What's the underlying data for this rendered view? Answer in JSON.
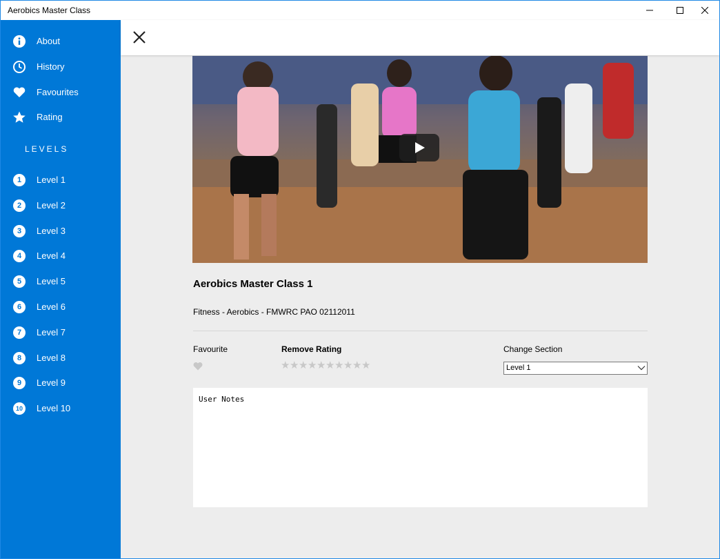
{
  "window": {
    "title": "Aerobics Master Class"
  },
  "sidebar": {
    "menu": [
      {
        "label": "About",
        "icon": "info-icon"
      },
      {
        "label": "History",
        "icon": "clock-icon"
      },
      {
        "label": "Favourites",
        "icon": "heart-icon"
      },
      {
        "label": "Rating",
        "icon": "star-icon"
      }
    ],
    "levels_heading": "LEVELS",
    "levels": [
      {
        "num": "1",
        "label": "Level 1"
      },
      {
        "num": "2",
        "label": "Level 2"
      },
      {
        "num": "3",
        "label": "Level 3"
      },
      {
        "num": "4",
        "label": "Level 4"
      },
      {
        "num": "5",
        "label": "Level 5"
      },
      {
        "num": "6",
        "label": "Level 6"
      },
      {
        "num": "7",
        "label": "Level 7"
      },
      {
        "num": "8",
        "label": "Level 8"
      },
      {
        "num": "9",
        "label": "Level 9"
      },
      {
        "num": "10",
        "label": "Level 10"
      }
    ],
    "color": "#0078d7"
  },
  "video": {
    "title": "Aerobics Master Class 1",
    "description": "Fitness - Aerobics - FMWRC PAO 02112011"
  },
  "controls": {
    "favourite_label": "Favourite",
    "rating_label": "Remove Rating",
    "rating_value": 0,
    "rating_max": 10,
    "section_label": "Change Section",
    "section_value": "Level 1"
  },
  "notes": {
    "placeholder": "User Notes"
  }
}
